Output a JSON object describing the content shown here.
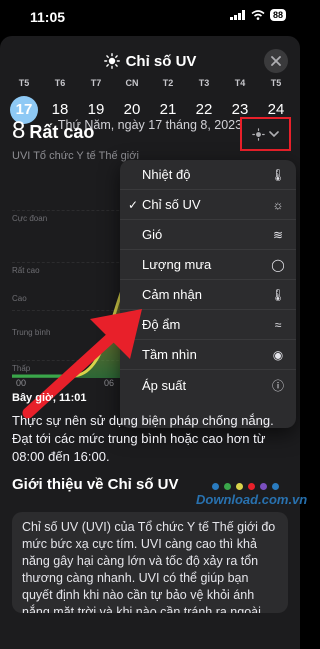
{
  "status": {
    "time": "11:05",
    "battery": "88"
  },
  "header": {
    "title": "Chỉ số UV",
    "icon": "sun-icon",
    "close_icon": "close-icon"
  },
  "week": [
    {
      "abbr": "T5",
      "num": "17",
      "selected": true
    },
    {
      "abbr": "T6",
      "num": "18"
    },
    {
      "abbr": "T7",
      "num": "19"
    },
    {
      "abbr": "CN",
      "num": "20"
    },
    {
      "abbr": "T2",
      "num": "21"
    },
    {
      "abbr": "T3",
      "num": "22"
    },
    {
      "abbr": "T4",
      "num": "23"
    },
    {
      "abbr": "T5",
      "num": "24"
    }
  ],
  "date_line": "Thứ Năm, ngày 17 tháng 8, 2023",
  "uv": {
    "value": "8",
    "level": "Rất cao",
    "source": "UVI Tổ chức Y tế Thế giới"
  },
  "chart": {
    "levels": [
      "Cực đoan",
      "Rất cao",
      "Cao",
      "Trung bình",
      "Thấp"
    ],
    "xticks": [
      "00",
      "06"
    ],
    "colors": {
      "low": "#3aa64a",
      "mid": "#c9c63a",
      "high": "#e8202a"
    }
  },
  "menu": {
    "items": [
      {
        "label": "Nhiệt độ",
        "icon": "thermometer-icon",
        "checked": false
      },
      {
        "label": "Chỉ số UV",
        "icon": "sun-icon",
        "checked": true
      },
      {
        "label": "Gió",
        "icon": "wind-icon",
        "checked": false
      },
      {
        "label": "Lượng mưa",
        "icon": "drop-icon",
        "checked": false
      },
      {
        "label": "Cảm nhận",
        "icon": "thermometer-icon",
        "checked": false
      },
      {
        "label": "Độ ẩm",
        "icon": "humidity-icon",
        "checked": false
      },
      {
        "label": "Tầm nhìn",
        "icon": "eye-icon",
        "checked": false
      },
      {
        "label": "Áp suất",
        "icon": "gauge-icon",
        "checked": false
      }
    ]
  },
  "now_label": "Bây giờ, 11:01",
  "advice": "Thực sự nên sử dụng biện pháp chống nắng. Đạt tới các mức trung bình hoặc cao hơn từ 08:00 đến 16:00.",
  "section_title": "Giới thiệu về Chỉ số UV",
  "watermark": "Download.com.vn",
  "about": "Chỉ số UV (UVI) của Tổ chức Y tế Thế giới đo mức bức xạ cực tím. UVI càng cao thì khả năng gây hại càng lớn và tốc độ xảy ra tổn thương càng nhanh. UVI có thể giúp bạn quyết định khi nào cần tự bảo vệ khỏi ánh nắng mặt trời và khi nào cần tránh ra ngoài trời. WHO khuyến cáo sử dụng mũ, kem chống nắng, nón và quần áo bảo"
}
